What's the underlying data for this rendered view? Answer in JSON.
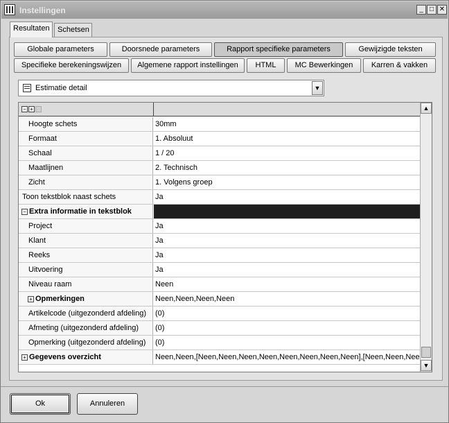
{
  "window": {
    "title": "Instellingen",
    "minimize_glyph": "_",
    "maximize_glyph": "□",
    "close_glyph": "✕"
  },
  "tabs": [
    {
      "label": "Resultaten",
      "active": true
    },
    {
      "label": "Schetsen",
      "active": false
    }
  ],
  "param_buttons_row1": [
    {
      "label": "Globale parameters"
    },
    {
      "label": "Doorsnede parameters"
    },
    {
      "label": "Rapport specifieke parameters",
      "active": true
    },
    {
      "label": "Gewijzigde teksten"
    }
  ],
  "param_buttons_row2": [
    {
      "label": "Specifieke berekeningswijzen"
    },
    {
      "label": "Algemene rapport instellingen"
    },
    {
      "label": "HTML"
    },
    {
      "label": "MC Bewerkingen"
    },
    {
      "label": "Karren & vakken"
    }
  ],
  "report_select": {
    "value": "Estimatie detail",
    "arrow_glyph": "▼"
  },
  "grid": {
    "header_icons": [
      "collapse-all-icon",
      "expand-all-icon"
    ],
    "rows": [
      {
        "label": "Hoogte schets",
        "value": "30mm"
      },
      {
        "label": "Formaat",
        "value": "1. Absoluut"
      },
      {
        "label": "Schaal",
        "value": "1 / 20"
      },
      {
        "label": "Maatlijnen",
        "value": "2. Technisch"
      },
      {
        "label": "Zicht",
        "value": "1. Volgens groep"
      },
      {
        "label": "Toon tekstblok naast schets",
        "value": "Ja"
      },
      {
        "label": "Extra informatie in tekstblok",
        "value": ""
      },
      {
        "label": "Project",
        "value": "Ja"
      },
      {
        "label": "Klant",
        "value": "Ja"
      },
      {
        "label": "Reeks",
        "value": "Ja"
      },
      {
        "label": "Uitvoering",
        "value": "Ja"
      },
      {
        "label": "Niveau raam",
        "value": "Neen"
      },
      {
        "label": "Opmerkingen",
        "value": "Neen,Neen,Neen,Neen"
      },
      {
        "label": "Artikelcode (uitgezonderd afdeling)",
        "value": "(0)"
      },
      {
        "label": "Afmeting (uitgezonderd afdeling)",
        "value": "(0)"
      },
      {
        "label": "Opmerking (uitgezonderd afdeling)",
        "value": "(0)"
      },
      {
        "label": "Gegevens overzicht",
        "value": "Neen,Neen,[Neen,Neen,Neen,Neen,Neen,Neen,Neen,Neen],[Neen,Neen,Neen"
      }
    ]
  },
  "dialog": {
    "ok_label": "Ok",
    "cancel_label": "Annuleren"
  }
}
